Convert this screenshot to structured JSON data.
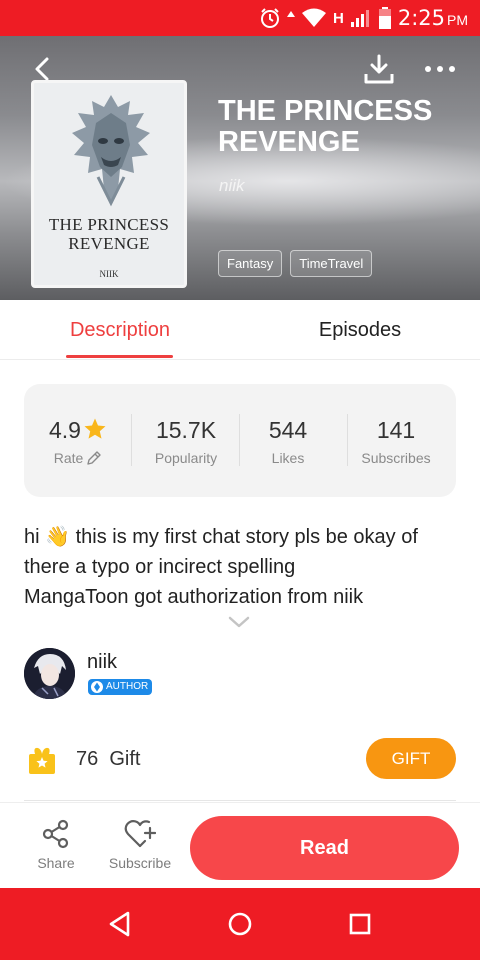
{
  "status_bar": {
    "time": "2:25",
    "ampm": "PM",
    "network": "H"
  },
  "book": {
    "title": "THE PRINCESS REVENGE",
    "author": "niik",
    "cover_title": "THE PRINCESS REVENGE",
    "cover_author": "NIIK",
    "tags": [
      "Fantasy",
      "TimeTravel"
    ]
  },
  "tabs": {
    "description": "Description",
    "episodes": "Episodes",
    "active": "Description"
  },
  "stats": {
    "rate": {
      "value": "4.9",
      "label": "Rate"
    },
    "popularity": {
      "value": "15.7K",
      "label": "Popularity"
    },
    "likes": {
      "value": "544",
      "label": "Likes"
    },
    "subscribes": {
      "value": "141",
      "label": "Subscribes"
    }
  },
  "description": {
    "line1": "hi 👋 this is my first chat story pls be okay of",
    "line2": "there a typo or incirect spelling",
    "line3": "MangaToon got authorization from niik"
  },
  "author": {
    "name": "niik",
    "badge": "AUTHOR"
  },
  "gift": {
    "count": "76",
    "label": "Gift",
    "button": "GIFT"
  },
  "actions": {
    "share": "Share",
    "subscribe": "Subscribe",
    "read": "Read"
  },
  "colors": {
    "accent": "#ee3f3f",
    "status_bar": "#ee1c24",
    "read_button": "#f7474a",
    "gift_button": "#f89611",
    "star": "#f9b61b",
    "badge": "#1d8ae8"
  },
  "icons": [
    "alarm-icon",
    "wifi-icon",
    "signal-icon",
    "battery-icon",
    "back-icon",
    "download-icon",
    "more-icon",
    "star-icon",
    "pencil-icon",
    "chevron-down-icon",
    "gift-icon",
    "share-icon",
    "subscribe-heart-icon",
    "nav-back-icon",
    "nav-home-icon",
    "nav-recents-icon"
  ]
}
